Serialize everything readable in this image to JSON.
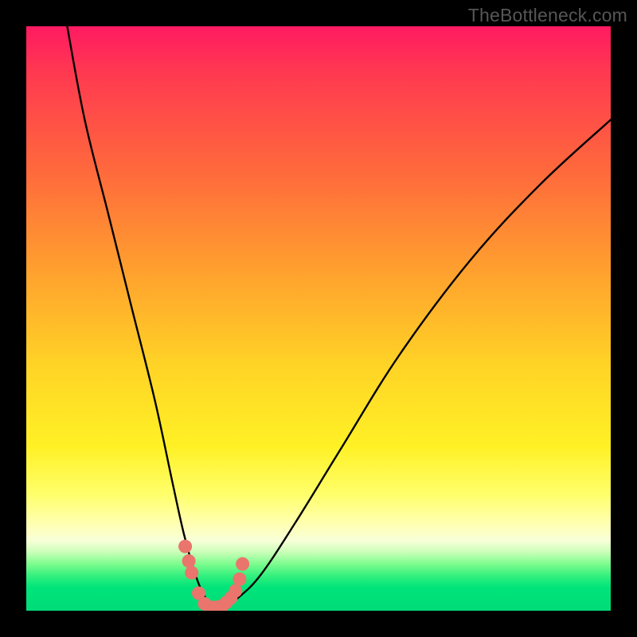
{
  "watermark": "TheBottleneck.com",
  "chart_data": {
    "type": "line",
    "title": "",
    "xlabel": "",
    "ylabel": "",
    "xlim": [
      0,
      100
    ],
    "ylim": [
      0,
      100
    ],
    "series": [
      {
        "name": "bottleneck-curve",
        "x": [
          7,
          10,
          14,
          18,
          22,
          25,
          27,
          29,
          30.5,
          32,
          34,
          36,
          40,
          46,
          54,
          64,
          76,
          88,
          100
        ],
        "values": [
          100,
          84,
          68,
          52,
          36,
          22,
          13,
          6,
          2.5,
          0.5,
          0.5,
          2,
          6,
          15,
          28,
          44,
          60,
          73,
          84
        ]
      }
    ],
    "markers": {
      "name": "highlight-dots",
      "color": "#e9756c",
      "x": [
        27.2,
        27.8,
        28.3,
        29.5,
        30.5,
        31.5,
        32.5,
        33.5,
        34.2,
        35.0,
        35.8,
        36.5,
        37.0
      ],
      "values": [
        11.0,
        8.5,
        6.5,
        3.0,
        1.2,
        0.6,
        0.6,
        0.8,
        1.4,
        2.2,
        3.4,
        5.4,
        8.0
      ]
    },
    "background_gradient": {
      "top": "#ff1a62",
      "mid": "#fff126",
      "bottom": "#00db78"
    }
  }
}
